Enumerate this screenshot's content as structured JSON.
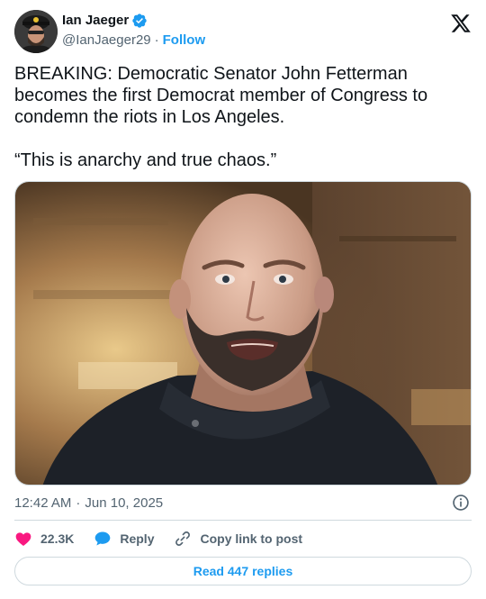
{
  "author": {
    "display_name": "Ian Jaeger",
    "handle": "@IanJaeger29",
    "separator": "·",
    "follow_label": "Follow",
    "verified_color": "#1d9bf0"
  },
  "tweet": {
    "text": "BREAKING: Democratic Senator John Fetterman becomes the first Democrat member of Congress to condemn the riots in Los Angeles.\n\n“This is anarchy and true chaos.”",
    "time": "12:42 AM",
    "date": "Jun 10, 2025",
    "separator": "·"
  },
  "actions": {
    "like_count": "22.3K",
    "reply_label": "Reply",
    "copy_link_label": "Copy link to post",
    "read_replies_label": "Read 447 replies"
  },
  "colors": {
    "accent": "#1d9bf0",
    "like": "#f91880",
    "text": "#0f1419",
    "secondary": "#536471",
    "border": "#cfd9de"
  },
  "icons": {
    "platform_logo": "x-logo-icon",
    "verified": "verified-badge-icon",
    "info": "info-icon",
    "like": "heart-icon",
    "reply": "speech-bubble-icon",
    "copy_link": "link-icon"
  }
}
